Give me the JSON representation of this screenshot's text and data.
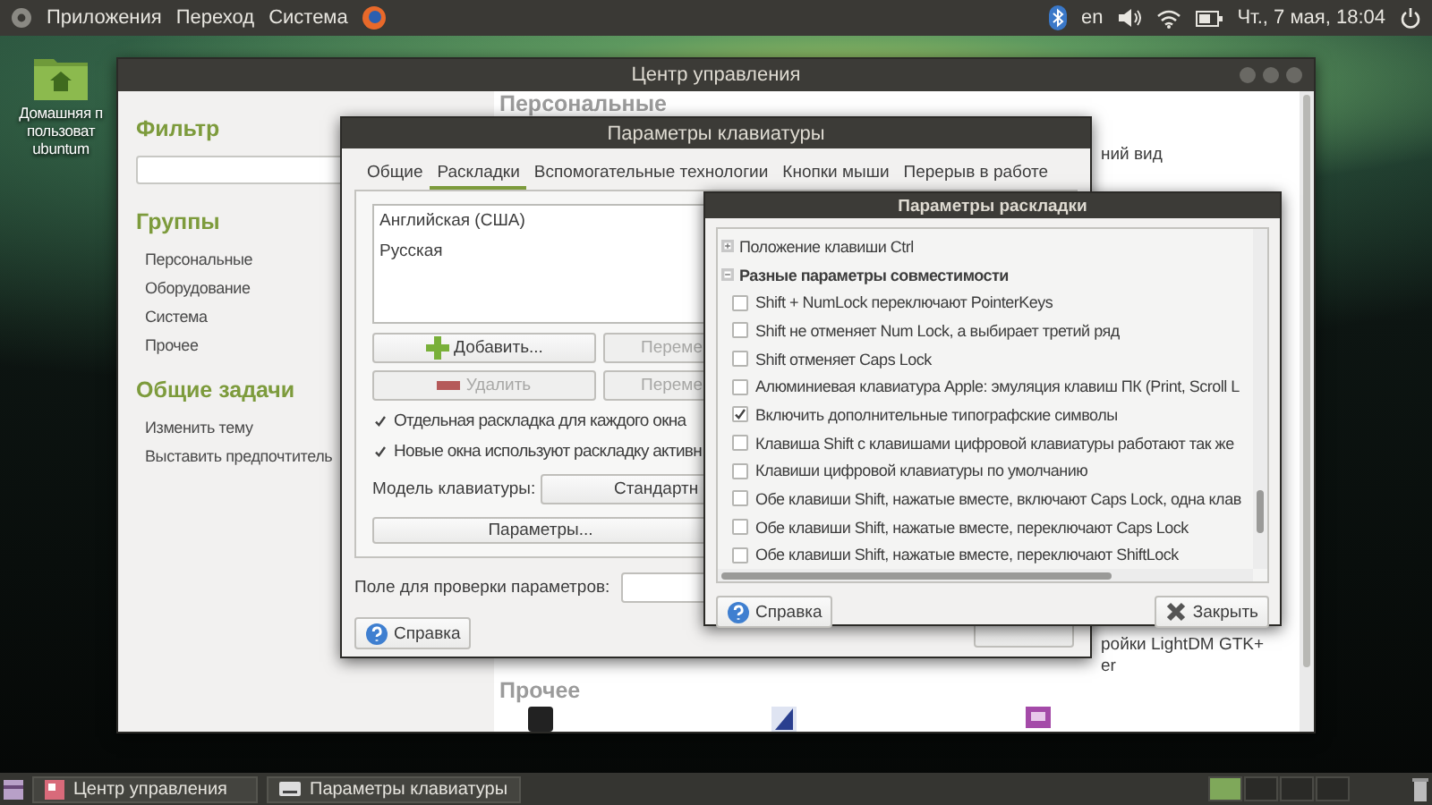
{
  "top_panel": {
    "menus": [
      "Приложения",
      "Переход",
      "Система"
    ],
    "keyboard_layout": "en",
    "clock": "Чт., 7 мая, 18:04"
  },
  "desktop_icon": {
    "label_lines": [
      "Домашняя п",
      "пользоват",
      "ubuntum"
    ]
  },
  "control_center": {
    "title": "Центр управления",
    "filter_heading": "Фильтр",
    "groups_heading": "Группы",
    "groups": [
      "Персональные",
      "Оборудование",
      "Система",
      "Прочее"
    ],
    "tasks_heading": "Общие задачи",
    "tasks": [
      "Изменить тему",
      "Выставить предпочтитель"
    ],
    "top_heading": "Персональные",
    "partial_top": "ний вид",
    "partial_bottom": [
      "ройки LightDM GTK+",
      "er"
    ],
    "bottom_heading": "Прочее"
  },
  "keyboard_dialog": {
    "title": "Параметры клавиатуры",
    "tabs": [
      {
        "label": "Общие",
        "selected": false
      },
      {
        "label": "Раскладки",
        "selected": true
      },
      {
        "label": "Вспомогательные технологии",
        "selected": false
      },
      {
        "label": "Кнопки мыши",
        "selected": false
      },
      {
        "label": "Перерыв в работе",
        "selected": false
      }
    ],
    "layouts": [
      "Английская (США)",
      "Русская"
    ],
    "buttons": [
      {
        "label": "Добавить...",
        "kind": "add",
        "disabled": false
      },
      {
        "label": "Переме",
        "kind": "plain",
        "disabled": true
      },
      {
        "label": "Удалить",
        "kind": "remove",
        "disabled": true
      },
      {
        "label": "Переме",
        "kind": "plain",
        "disabled": true
      }
    ],
    "checks": [
      {
        "label": "Отдельная раскладка для каждого окна",
        "checked": true
      },
      {
        "label": "Новые окна используют раскладку активн",
        "checked": true
      }
    ],
    "model_label": "Модель клавиатуры:",
    "model_value": "Стандартн",
    "options_button": "Параметры...",
    "test_label": "Поле для проверки параметров:",
    "help_button": "Справка"
  },
  "layout_options": {
    "title": "Параметры раскладки",
    "tree": [
      {
        "label": "Положение клавиши Ctrl",
        "expanded": false
      },
      {
        "label": "Разные параметры совместимости",
        "expanded": true,
        "children": [
          {
            "label": "Shift + NumLock переключают PointerKeys",
            "checked": false
          },
          {
            "label": "Shift не отменяет Num Lock, а выбирает третий ряд",
            "checked": false
          },
          {
            "label": "Shift отменяет Caps Lock",
            "checked": false
          },
          {
            "label": "Алюминиевая клавиатура Apple: эмуляция клавиш ПК (Print, Scroll L",
            "checked": false
          },
          {
            "label": "Включить дополнительные типографские символы",
            "checked": true
          },
          {
            "label": "Клавиша Shift с клавишами цифровой клавиатуры работают так же",
            "checked": false
          },
          {
            "label": "Клавиши цифровой клавиатуры по умолчанию",
            "checked": false
          },
          {
            "label": "Обе клавиши Shift, нажатые вместе, включают Caps Lock, одна клав",
            "checked": false
          },
          {
            "label": "Обе клавиши Shift, нажатые вместе, переключают Caps Lock",
            "checked": false
          },
          {
            "label": "Обе клавиши Shift, нажатые вместе, переключают ShiftLock",
            "checked": false
          }
        ]
      }
    ],
    "help_button": "Справка",
    "close_button": "Закрыть"
  },
  "taskbar": {
    "windows": [
      "Центр управления",
      "Параметры клавиатуры"
    ]
  }
}
